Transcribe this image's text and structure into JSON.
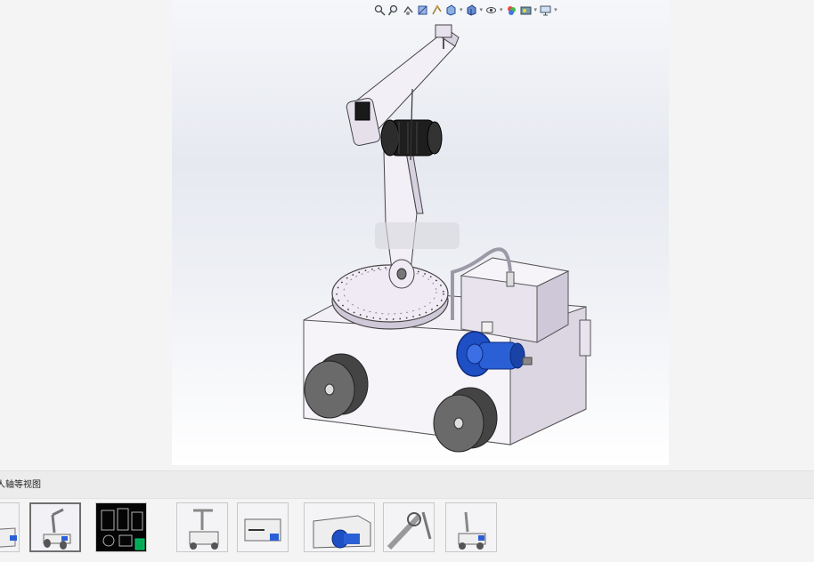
{
  "viewer": {
    "toolbar_icons": [
      "zoom-to-fit-icon",
      "zoom-area-icon",
      "previous-view-icon",
      "section-view-icon",
      "dynamic-annotation-icon",
      "view-orientation-icon",
      "display-style-icon",
      "hide-show-items-icon",
      "edit-appearance-icon",
      "apply-scene-icon",
      "view-settings-icon"
    ],
    "background_top": "#f6f7fa",
    "model_colors": {
      "body": "#f3eff6",
      "shade": "#cfc8d8",
      "motor_blue": "#1f4fc4",
      "wheel": "#5a5a5a",
      "gripper_motor": "#1e1e1e"
    }
  },
  "caption": {
    "title": "器人轴等视图"
  },
  "thumbnails": [
    {
      "name": "thumb-1",
      "style": "iso-partial"
    },
    {
      "name": "thumb-2",
      "style": "iso",
      "selected": true
    },
    {
      "name": "thumb-3",
      "style": "drawing-dark"
    },
    {
      "name": "thumb-4",
      "style": "front"
    },
    {
      "name": "thumb-5",
      "style": "side"
    },
    {
      "name": "thumb-6",
      "style": "closeup-pump"
    },
    {
      "name": "thumb-7",
      "style": "closeup-arm"
    },
    {
      "name": "thumb-8",
      "style": "iso-small"
    }
  ]
}
